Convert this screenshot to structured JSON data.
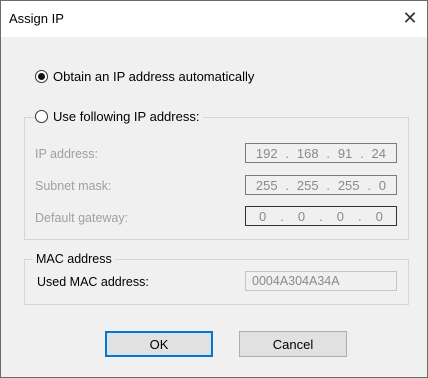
{
  "window": {
    "title": "Assign IP",
    "close_glyph": "✕"
  },
  "options": {
    "auto": "Obtain an IP address automatically",
    "manual": "Use following IP address:"
  },
  "ip": {
    "address_label": "IP address:",
    "address": [
      "192",
      "168",
      "91",
      "24"
    ],
    "subnet_label": "Subnet mask:",
    "subnet": [
      "255",
      "255",
      "255",
      "0"
    ],
    "gateway_label": "Default gateway:",
    "gateway": [
      "0",
      "0",
      "0",
      "0"
    ]
  },
  "mac": {
    "group_label": "MAC address",
    "used_label": "Used MAC address:",
    "value": "0004A304A34A"
  },
  "buttons": {
    "ok": "OK",
    "cancel": "Cancel"
  },
  "colors": {
    "accent": "#0078d7",
    "disabled_text": "#a0a0a0"
  },
  "icons": {
    "close": "close-icon",
    "radio": "radio-icon"
  }
}
